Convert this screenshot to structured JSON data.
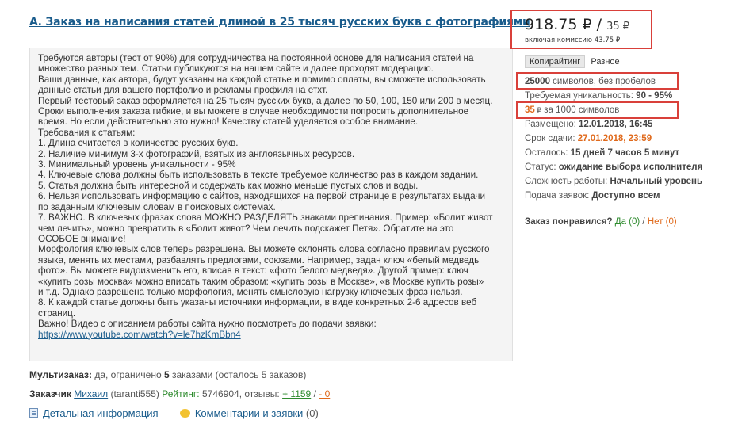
{
  "order": {
    "title": "А. Заказ на написания статей длиной в 25 тысяч русских букв с фотографиями",
    "description_lines": [
      "Требуются авторы (тест от 90%) для сотрудничества на постоянной основе для написания статей на",
      "множество разных тем. Статьи публикуются на нашем сайте и далее проходят модерацию.",
      "Ваши данные, как автора, будут указаны на каждой статье и помимо оплаты, вы сможете использовать",
      "данные статьи для вашего портфолио и рекламы профиля на етхт.",
      "Первый тестовый заказ оформляется на 25 тысяч русских букв, а далее по 50, 100, 150 или 200 в месяц.",
      "Сроки выполнения заказа гибкие, и вы можете в случае необходимости попросить дополнительное",
      "время. Но если действительно это нужно! Качеству статей уделяется особое внимание.",
      "Требования к статьям:",
      "1. Длина считается в количестве русских букв.",
      "2. Наличие минимум 3-х фотографий, взятых из англоязычных ресурсов.",
      "3. Минимальный уровень уникальности - 95%",
      "4. Ключевые слова должны быть использовать в тексте требуемое количество раз в каждом задании.",
      "5. Статья должна быть интересной и содержать как можно меньше пустых слов и воды.",
      "6. Нельзя использовать информацию с сайтов, находящихся на первой странице в результатах выдачи",
      "по заданным ключевым словам в поисковых системах.",
      "7. ВАЖНО. В ключевых фразах слова МОЖНО РАЗДЕЛЯТЬ знаками препинания. Пример: «Болит живот",
      "чем лечить», можно превратить в «Болит живот? Чем лечить подскажет Петя». Обратите на это",
      "ОСОБОЕ внимание!",
      "Морфология ключевых слов теперь разрешена. Вы можете склонять слова согласно правилам русского",
      "языка, менять их местами, разбавлять предлогами, союзами. Например, задан ключ «белый медведь",
      "фото». Вы можете видоизменить его, вписав в текст: «фото белого медведя». Другой пример: ключ",
      "«купить розы москва» можно вписать таким образом: «купить розы в Москве», «в Москве купить розы»",
      "и т.д. Однако разрешена только морфология, менять смысловую нагрузку ключевых фраз нельзя.",
      "8. К каждой статье должны быть указаны источники информации, в виде конкретных 2-6 адресов веб",
      "страниц.",
      "Важно! Видео с описанием работы сайта нужно посмотреть до подачи заявки:"
    ],
    "video_link": "https://www.youtube.com/watch?v=le7hzKmBbn4",
    "multi_label": "Мультизаказ:",
    "multi_text_1": " да, ограничено ",
    "multi_count": "5",
    "multi_text_2": " заказами (осталось 5 заказов)",
    "customer_label": "Заказчик",
    "customer_name": "Михаил",
    "customer_login": "(taranti555)",
    "rating_label": "Рейтинг:",
    "rating_value": "5746904",
    "reviews_label": ", отзывы:",
    "reviews_positive": "+ 1159",
    "reviews_sep": " / ",
    "reviews_negative": "- 0",
    "details_link": "Детальная информация",
    "comments_link": "Комментарии и заявки",
    "comments_count": " (0)"
  },
  "sidebar": {
    "price_value": "918.75 ₽",
    "price_slash": " / ",
    "price_rate": "35 ₽",
    "price_fee": "включая комиссию 43.75 ₽",
    "tag_active": "Копирайтинг",
    "tag_other": "Разное",
    "volume_value": "25000",
    "volume_text": " символов, без пробелов",
    "uniq_label": "Требуемая уникальность: ",
    "uniq_value": "90 - 95%",
    "rate_value": "35",
    "rate_cur": " ₽",
    "rate_text": " за 1000 символов",
    "placed_label": "Размещено: ",
    "placed_value": "12.01.2018, 16:45",
    "deadline_label": "Срок сдачи: ",
    "deadline_value": "27.01.2018, 23:59",
    "left_label": "Осталось: ",
    "left_value": "15 дней 7 часов 5 минут",
    "status_label": "Статус: ",
    "status_value": "ожидание выбора исполнителя",
    "complexity_label": "Сложность работы: ",
    "complexity_value": "Начальный уровень",
    "apply_label": "Подача заявок: ",
    "apply_value": "Доступно всем",
    "like_label": "Заказ понравился?",
    "like_yes": "Да",
    "like_yes_count": "(0)",
    "like_sep": " / ",
    "like_no": "Нет",
    "like_no_count": "(0)"
  },
  "colors": {
    "link": "#1a5c8c",
    "highlight_border": "#d9403a",
    "positive": "#2e8b2e",
    "deadline": "#e06a1c"
  }
}
